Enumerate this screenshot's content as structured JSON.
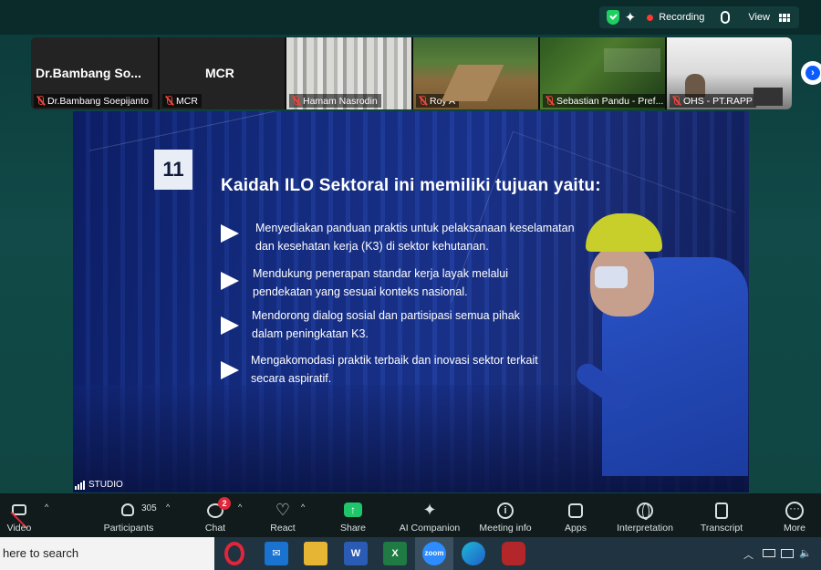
{
  "topbar": {
    "recording_label": "Recording",
    "view_label": "View",
    "icons": [
      "shield-check-icon",
      "sparkle-icon",
      "microphone-icon",
      "grid-icon"
    ]
  },
  "participants": [
    {
      "big_name": "Dr.Bambang  So...",
      "label": "Dr.Bambang Soepijanto",
      "muted": true
    },
    {
      "big_name": "MCR",
      "label": "MCR",
      "muted": true
    },
    {
      "big_name": "",
      "label": "Hamam Nasrodin",
      "muted": true
    },
    {
      "big_name": "",
      "label": "Roy A",
      "muted": true
    },
    {
      "big_name": "",
      "label": "Sebastian Pandu - Pref...",
      "muted": true
    },
    {
      "big_name": "",
      "label": "OHS - PT.RAPP",
      "muted": true
    }
  ],
  "slide": {
    "sign_number": "11",
    "title": "Kaidah ILO Sektoral ini memiliki tujuan yaitu:",
    "bullets": [
      "Menyediakan panduan praktis untuk pelaksanaan keselamatan\ndan kesehatan kerja (K3) di sektor kehutanan.",
      "Mendukung penerapan standar kerja layak melalui\npendekatan yang sesuai konteks nasional.",
      "Mendorong dialog sosial dan partisipasi semua pihak\ndalam peningkatan K3.",
      "Mengakomodasi praktik terbaik dan inovasi sektor terkait\nsecara aspiratif."
    ],
    "studio_label": "STUDIO"
  },
  "toolbar": {
    "video": "Video",
    "participants": "Participants",
    "participants_count": "305",
    "chat": "Chat",
    "chat_badge": "2",
    "react": "React",
    "share": "Share",
    "ai_companion": "AI Companion",
    "meeting_info": "Meeting info",
    "apps": "Apps",
    "interpretation": "Interpretation",
    "transcript": "Transcript",
    "more": "More"
  },
  "taskbar": {
    "search_placeholder": "here to search",
    "apps": [
      "opera-icon",
      "mail-icon",
      "file-explorer-icon",
      "word-icon",
      "excel-icon",
      "zoom-icon",
      "edge-icon",
      "app-icon"
    ],
    "word_letter": "W",
    "excel_letter": "X",
    "zoom_label": "zoom"
  },
  "colors": {
    "recording_dot": "#ff3b30",
    "share_green": "#1fc56a",
    "mute_red": "#e7463d",
    "badge_red": "#e0263b"
  }
}
